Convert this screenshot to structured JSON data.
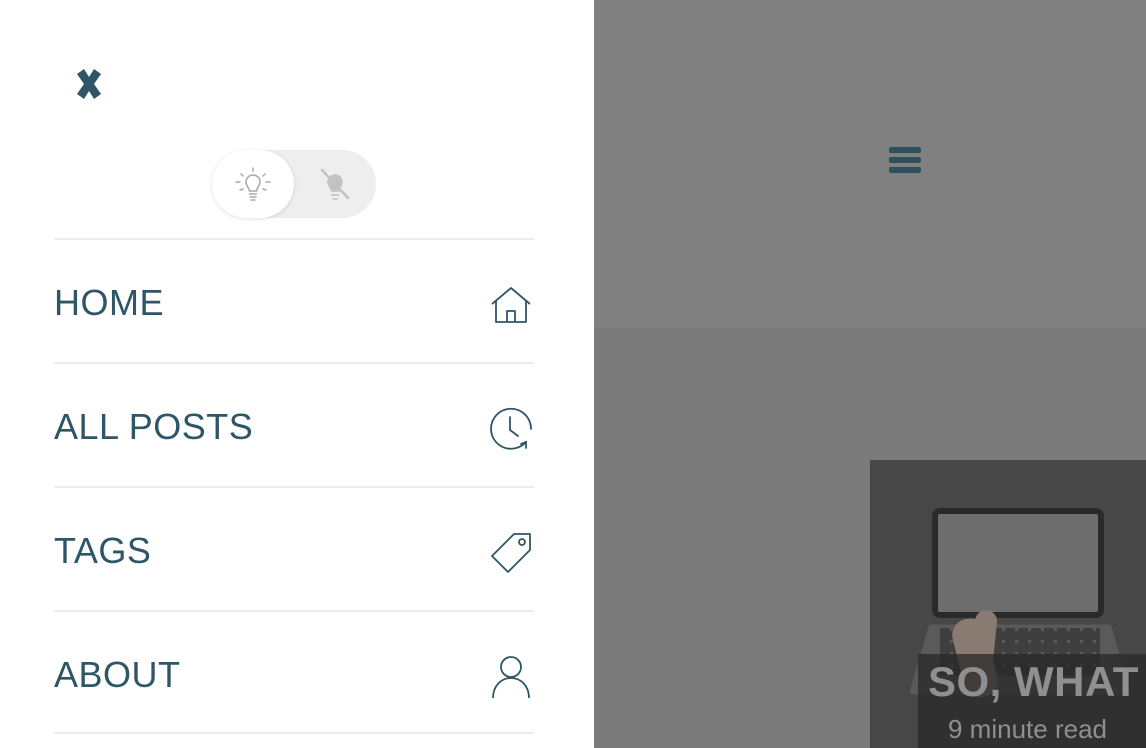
{
  "drawer": {
    "close_icon": "close-icon",
    "theme_toggle": {
      "light_icon": "lightbulb-on-icon",
      "dark_icon": "lightbulb-off-icon",
      "selected": "light"
    },
    "nav_items": [
      {
        "label": "HOME",
        "icon": "home-icon"
      },
      {
        "label": "ALL POSTS",
        "icon": "clock-history-icon"
      },
      {
        "label": "TAGS",
        "icon": "tag-icon"
      },
      {
        "label": "ABOUT",
        "icon": "user-icon"
      }
    ]
  },
  "header": {
    "menu_icon": "hamburger-icon"
  },
  "post": {
    "title": "SO, WHAT I",
    "read_time": "9 minute read"
  },
  "colors": {
    "accent": "#2e5666",
    "drawer_bg": "#ffffff",
    "overlay": "#808080"
  }
}
